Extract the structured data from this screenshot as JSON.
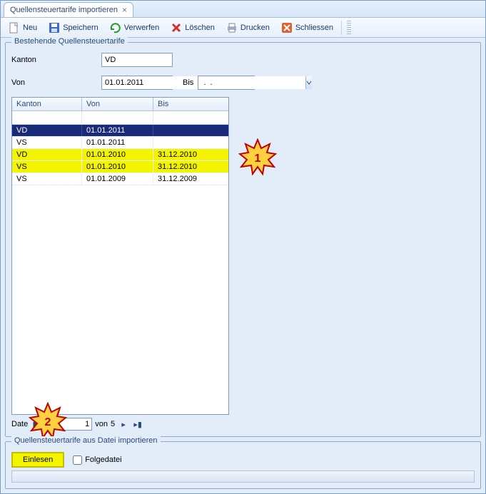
{
  "tab": {
    "title": "Quellensteuertarife importieren"
  },
  "toolbar": {
    "neu": "Neu",
    "speichern": "Speichern",
    "verwerfen": "Verwerfen",
    "loeschen": "Löschen",
    "drucken": "Drucken",
    "schliessen": "Schliessen"
  },
  "section1": {
    "legend": "Bestehende Quellensteuertarife",
    "kanton_label": "Kanton",
    "kanton_value": "VD",
    "von_label": "Von",
    "von_value": "01.01.2011",
    "bis_label": "Bis",
    "bis_value": " .  ."
  },
  "grid": {
    "headers": {
      "kanton": "Kanton",
      "von": "Von",
      "bis": "Bis"
    },
    "rows": [
      {
        "kanton": "VD",
        "von": "01.01.2011",
        "bis": "",
        "state": "selected"
      },
      {
        "kanton": "VS",
        "von": "01.01.2011",
        "bis": "",
        "state": ""
      },
      {
        "kanton": "VD",
        "von": "01.01.2010",
        "bis": "31.12.2010",
        "state": "hl"
      },
      {
        "kanton": "VS",
        "von": "01.01.2010",
        "bis": "31.12.2010",
        "state": "hl"
      },
      {
        "kanton": "VS",
        "von": "01.01.2009",
        "bis": "31.12.2009",
        "state": ""
      }
    ]
  },
  "nav": {
    "record_label": "Date",
    "page": "1",
    "von": "von",
    "total": "5"
  },
  "section2": {
    "legend": "Quellensteuertarife aus Datei importieren",
    "einlesen": "Einlesen",
    "folgedatei": "Folgedatei"
  },
  "callouts": {
    "one": "1",
    "two": "2"
  }
}
